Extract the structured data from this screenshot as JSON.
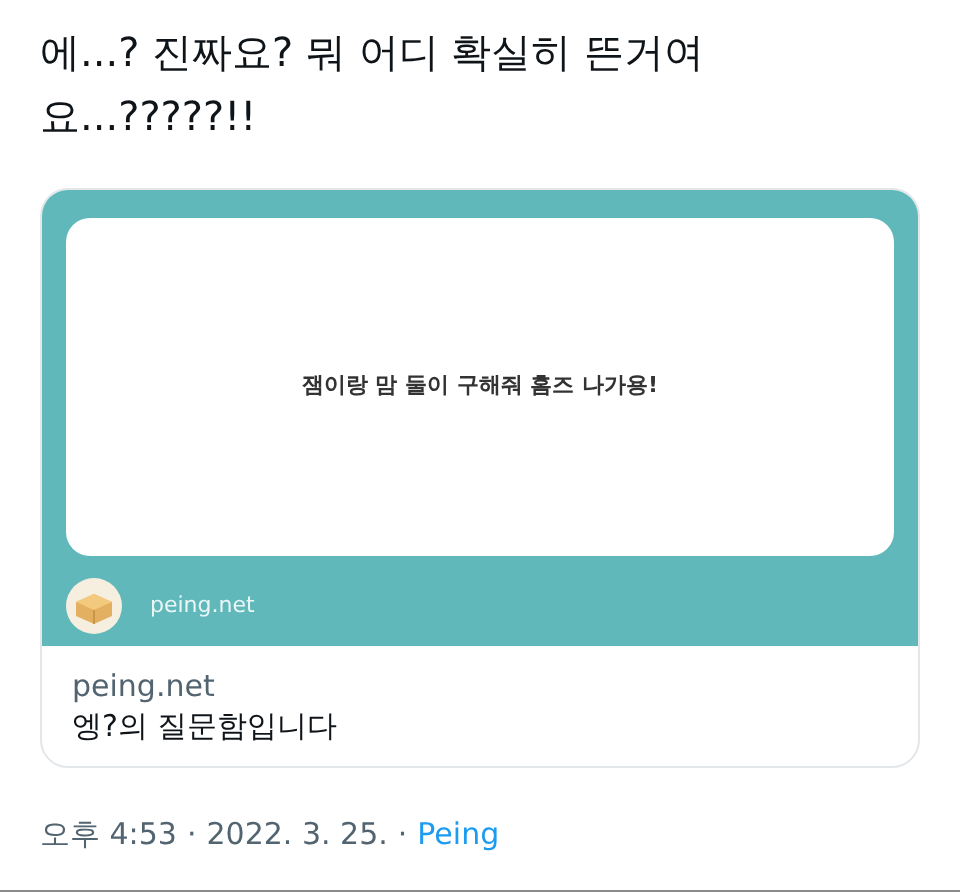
{
  "tweet": {
    "text": "에...? 진짜요? 뭐 어디 확실히 뜬거여요...?????!!"
  },
  "card": {
    "question": "잼이랑 맘 둘이 구해줘 홈즈 나가용!",
    "site_label": "peing.net",
    "domain": "peing.net",
    "title": "엥?의 질문함입니다"
  },
  "meta": {
    "time": "오후 4:53",
    "date": "2022. 3. 25.",
    "source": "Peing",
    "separator": "·"
  }
}
